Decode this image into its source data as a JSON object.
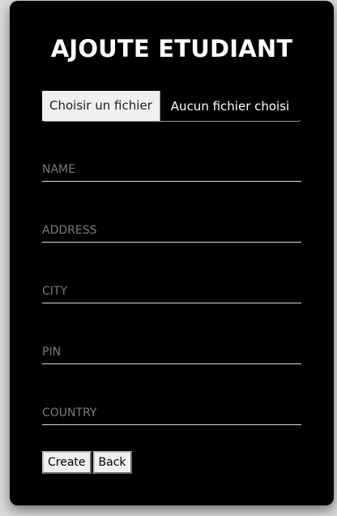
{
  "form": {
    "title": "AJOUTE ETUDIANT",
    "file": {
      "button_label": "Choisir un fichier",
      "status": "Aucun fichier choisi"
    },
    "fields": {
      "name_placeholder": "NAME",
      "address_placeholder": "ADDRESS",
      "city_placeholder": "CITY",
      "pin_placeholder": "PIN",
      "country_placeholder": "COUNTRY"
    },
    "actions": {
      "create_label": "Create",
      "back_label": "Back"
    }
  },
  "colors": {
    "card_background": "#000000",
    "page_background": "#d9d9d9",
    "text": "#ffffff",
    "placeholder": "#7a7a7a"
  }
}
